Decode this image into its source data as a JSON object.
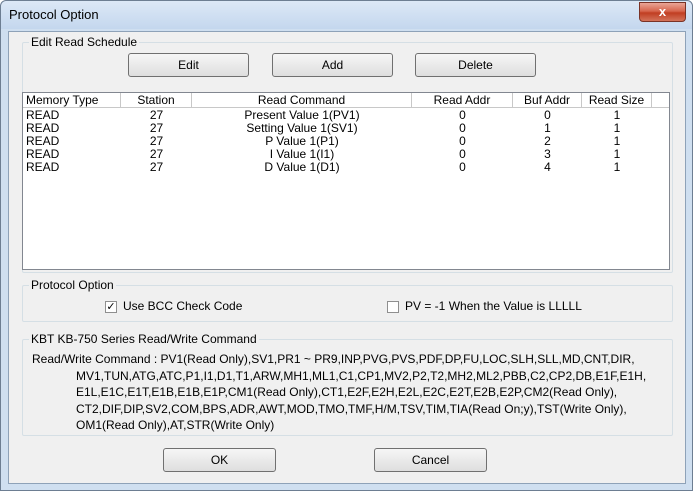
{
  "window": {
    "title": "Protocol Option",
    "close_label": "x"
  },
  "schedule": {
    "title": "Edit Read Schedule",
    "edit_label": "Edit",
    "add_label": "Add",
    "delete_label": "Delete",
    "columns": [
      "Memory Type",
      "Station",
      "Read Command",
      "Read Addr",
      "Buf Addr",
      "Read Size"
    ],
    "rows": [
      [
        "READ",
        "27",
        "Present Value 1(PV1)",
        "0",
        "0",
        "1"
      ],
      [
        "READ",
        "27",
        "Setting Value 1(SV1)",
        "0",
        "1",
        "1"
      ],
      [
        "READ",
        "27",
        "P Value 1(P1)",
        "0",
        "2",
        "1"
      ],
      [
        "READ",
        "27",
        "I Value 1(I1)",
        "0",
        "3",
        "1"
      ],
      [
        "READ",
        "27",
        "D Value 1(D1)",
        "0",
        "4",
        "1"
      ]
    ]
  },
  "protocol": {
    "title": "Protocol Option",
    "bcc_label": "Use BCC Check Code",
    "bcc_checked": true,
    "bcc_mark": "✓",
    "pv_label": "PV = -1 When the Value is LLLLL",
    "pv_checked": false
  },
  "command": {
    "title": "KBT KB-750 Series Read/Write Command",
    "lines": [
      "Read/Write Command : PV1(Read Only),SV1,PR1 ~ PR9,INP,PVG,PVS,PDF,DP,FU,LOC,SLH,SLL,MD,CNT,DIR,",
      "MV1,TUN,ATG,ATC,P1,I1,D1,T1,ARW,MH1,ML1,C1,CP1,MV2,P2,T2,MH2,ML2,PBB,C2,CP2,DB,E1F,E1H,",
      "E1L,E1C,E1T,E1B,E1B,E1P,CM1(Read Only),CT1,E2F,E2H,E2L,E2C,E2T,E2B,E2P,CM2(Read Only),",
      "CT2,DIF,DIP,SV2,COM,BPS,ADR,AWT,MOD,TMO,TMF,H/M,TSV,TIM,TIA(Read On;y),TST(Write Only),",
      "OM1(Read Only),AT,STR(Write Only)"
    ]
  },
  "footer": {
    "ok_label": "OK",
    "cancel_label": "Cancel"
  }
}
